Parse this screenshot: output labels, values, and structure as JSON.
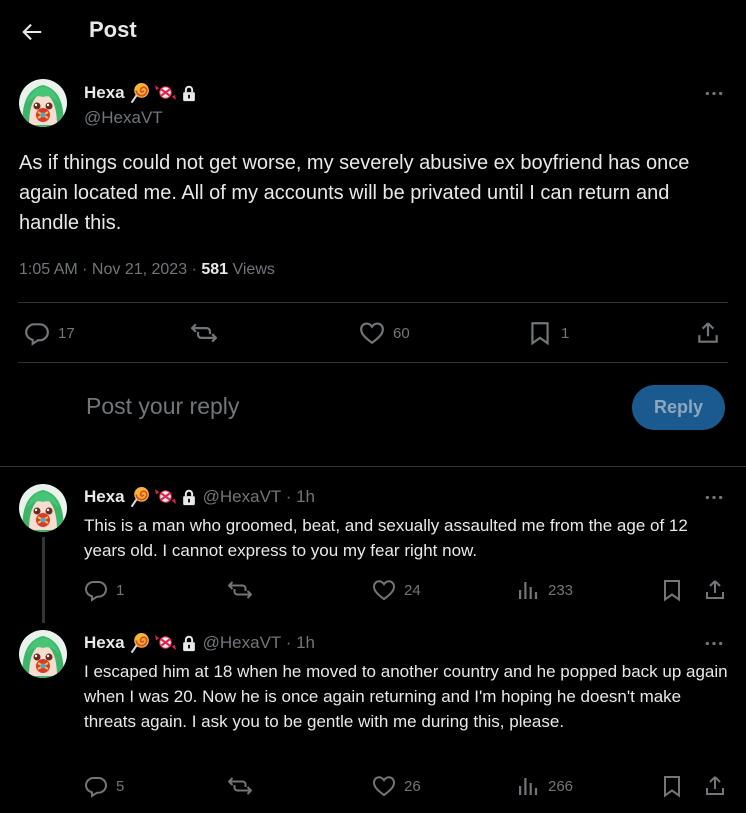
{
  "header": {
    "title": "Post"
  },
  "main_post": {
    "author_name": "Hexa",
    "handle": "@HexaVT",
    "text": "As if things could not get worse, my severely abusive ex boyfriend has once again located me. All of my accounts will be privated until I can return and handle this.",
    "time": "1:05 AM · Nov 21, 2023 · ",
    "views_count": "581",
    "views_label": " Views",
    "replies": "17",
    "likes": "60",
    "bookmarks": "1"
  },
  "composer": {
    "placeholder": "Post your reply",
    "button_label": "Reply"
  },
  "replies": [
    {
      "author_name": "Hexa",
      "handle_time": "@HexaVT · 1h",
      "text": "This is a man who groomed, beat, and sexually assaulted me from the age of 12 years old. I cannot express to you my fear right now.",
      "replies": "1",
      "likes": "24",
      "views": "233"
    },
    {
      "author_name": "Hexa",
      "handle_time": "@HexaVT · 1h",
      "text": "I escaped him at 18 when he moved to another country and he popped back up again when I was 20. Now he is once again returning and I'm hoping he doesn't make threats again. I ask you to be gentle with me during this, please.",
      "replies": "5",
      "likes": "26",
      "views": "266"
    }
  ],
  "colors": {
    "background": "#000000",
    "text": "#e7e9ea",
    "muted": "#71767b",
    "accent": "#1d9bf0",
    "divider": "#2f3336"
  },
  "icons": [
    "back-arrow-icon",
    "lollipop-icon",
    "candy-icon",
    "lock-icon",
    "more-icon",
    "reply-icon",
    "repost-icon",
    "like-icon",
    "bookmark-icon",
    "share-icon",
    "views-icon"
  ]
}
